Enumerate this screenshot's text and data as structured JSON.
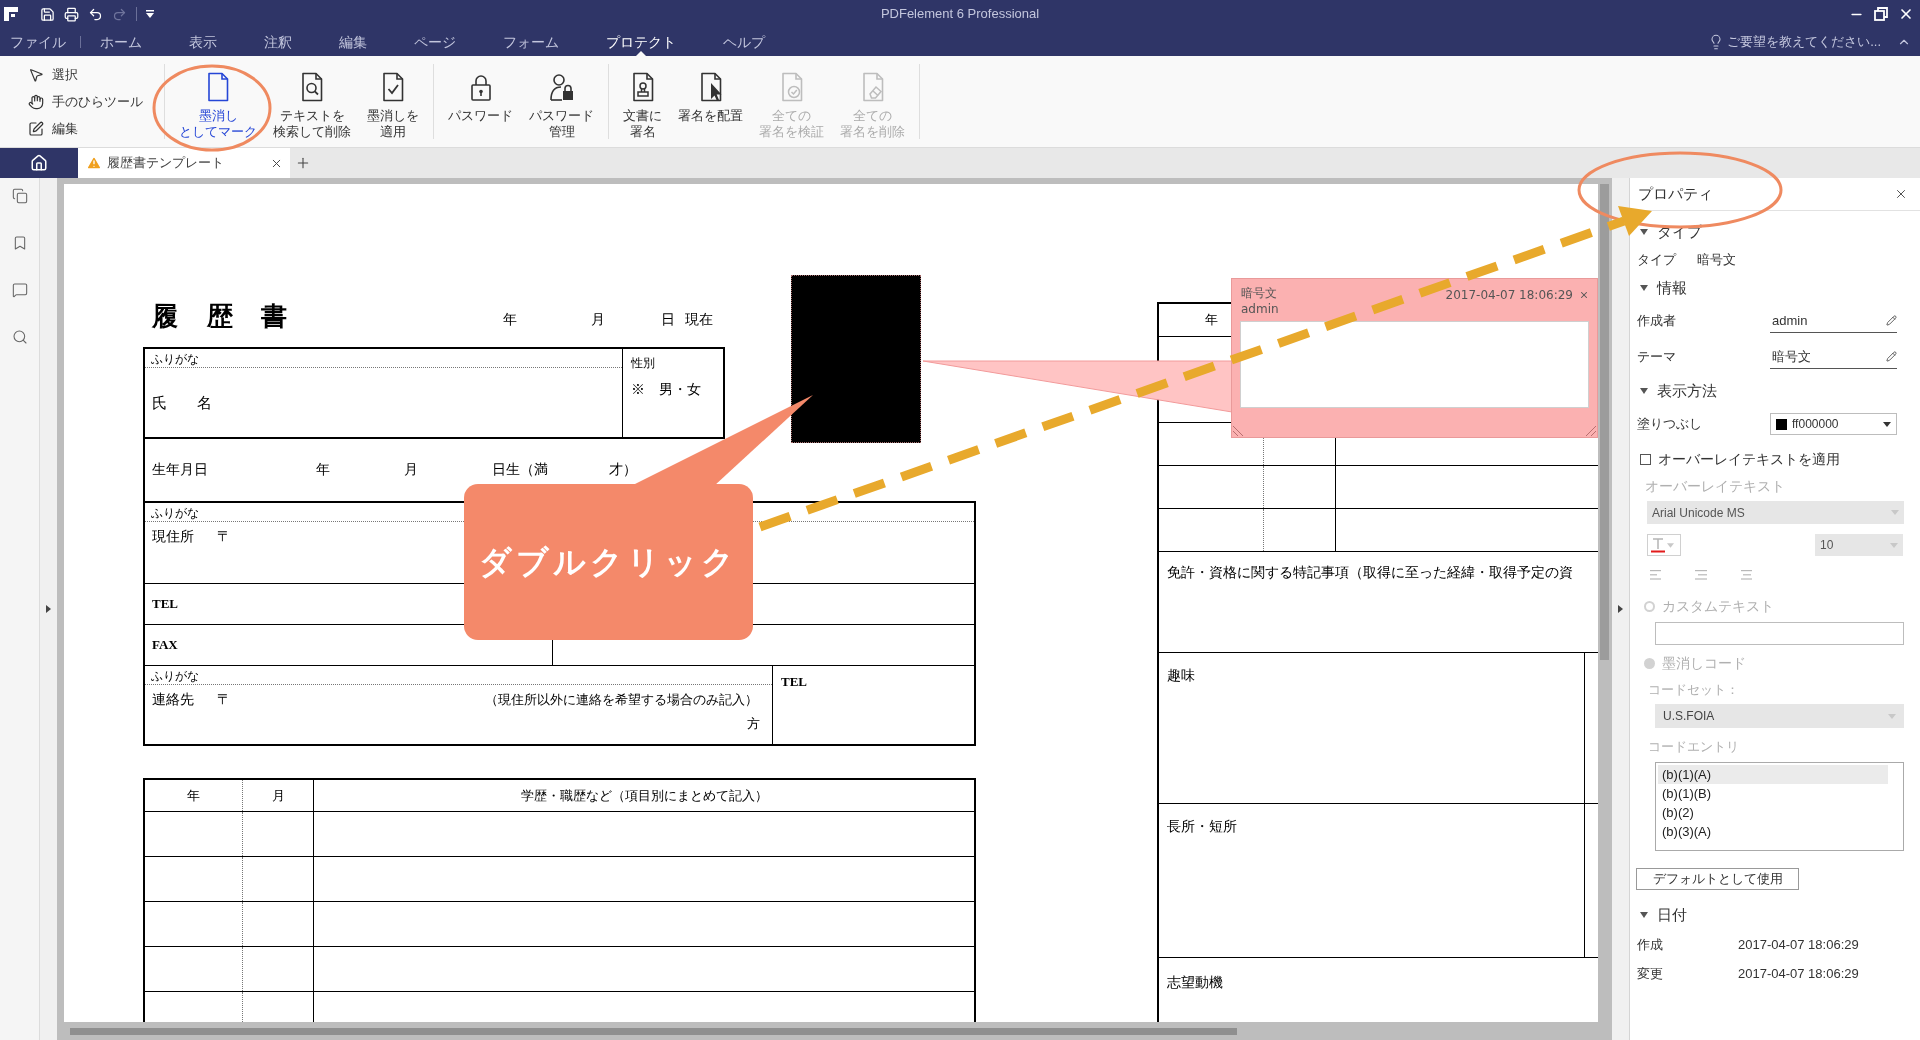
{
  "window": {
    "title": "PDFelement 6 Professional"
  },
  "quick_access": [
    {
      "kind": "save",
      "disabled": false
    },
    {
      "kind": "print",
      "disabled": false
    },
    {
      "kind": "undo",
      "disabled": false
    },
    {
      "kind": "redo",
      "disabled": true
    },
    {
      "kind": "customize",
      "disabled": false
    }
  ],
  "menu": [
    {
      "label": "ファイル",
      "selected": false
    },
    {
      "label": "ホーム",
      "selected": false
    },
    {
      "label": "表示",
      "selected": false
    },
    {
      "label": "注釈",
      "selected": false
    },
    {
      "label": "編集",
      "selected": false
    },
    {
      "label": "ページ",
      "selected": false
    },
    {
      "label": "フォーム",
      "selected": false
    },
    {
      "label": "プロテクト",
      "selected": true
    },
    {
      "label": "ヘルプ",
      "selected": false
    }
  ],
  "feedback": "ご要望を教えてください...",
  "ribbon": {
    "tools": [
      {
        "kind": "select",
        "label": "選択"
      },
      {
        "kind": "hand",
        "label": "手のひらツール"
      },
      {
        "kind": "edit",
        "label": "編集"
      }
    ],
    "groups": [
      [
        {
          "kind": "mark",
          "lines": [
            "墨消し",
            "としてマーク"
          ],
          "selected": true,
          "disabled": false
        },
        {
          "kind": "search",
          "lines": [
            "テキストを",
            "検索して削除"
          ],
          "selected": false,
          "disabled": false
        },
        {
          "kind": "apply",
          "lines": [
            "墨消しを",
            "適用"
          ],
          "selected": false,
          "disabled": false
        }
      ],
      [
        {
          "kind": "password",
          "lines": [
            "パスワード"
          ],
          "selected": false,
          "disabled": false
        },
        {
          "kind": "password_manage",
          "lines": [
            "パスワード",
            "管理"
          ],
          "selected": false,
          "disabled": false
        }
      ],
      [
        {
          "kind": "sign",
          "lines": [
            "文書に",
            "署名"
          ],
          "selected": false,
          "disabled": false
        },
        {
          "kind": "place_signature",
          "lines": [
            "署名を配置"
          ],
          "selected": false,
          "disabled": false
        },
        {
          "kind": "verify_all",
          "lines": [
            "全ての",
            "署名を検証"
          ],
          "selected": false,
          "disabled": true
        },
        {
          "kind": "remove_all",
          "lines": [
            "全ての",
            "署名を削除"
          ],
          "selected": false,
          "disabled": true
        }
      ]
    ]
  },
  "document_tabs": [
    {
      "label": "履歴書テンプレート",
      "selected": true,
      "warning": true
    }
  ],
  "sidebar": [
    {
      "kind": "pages"
    },
    {
      "kind": "bookmarks"
    },
    {
      "kind": "comments"
    },
    {
      "kind": "search"
    }
  ],
  "resume": {
    "title": "履 歴 書",
    "date": [
      "年",
      "月",
      "日 現在"
    ],
    "name_row": {
      "furigana": "ふりがな",
      "label": "氏 名",
      "gender_label": "性別",
      "gender": "※ 男・女"
    },
    "birth_row": [
      "生年月日",
      "年",
      "月",
      "日生（満",
      "才）"
    ],
    "address_row": {
      "furigana": "ふりがな",
      "label": "現住所",
      "postal": "〒"
    },
    "tel_row": "TEL",
    "fax_row": "FAX",
    "contact_row": {
      "furigana": "ふりがな",
      "label": "連絡先",
      "postal": "〒",
      "note": "（現住所以外に連絡を希望する場合のみ記入）",
      "suffix": "方",
      "tel": "TEL"
    },
    "history_table": {
      "columns": [
        "年",
        "月",
        "学歴・職歴など（項目別にまとめて記入）"
      ]
    },
    "licenses_table": {
      "columns": [
        "年"
      ],
      "remarks": "免許・資格に関する特記事項（取得に至った経緯・取得予定の資"
    },
    "hobbies": "趣味",
    "strengths": "長所・短所",
    "motivation": "志望動機"
  },
  "note": {
    "subject": "暗号文",
    "author": "admin",
    "date": "2017-04-07 18:06:29"
  },
  "callout": "ダブルクリック",
  "properties": {
    "title": "プロパティ",
    "type": {
      "heading": "タイプ",
      "expanded": true,
      "label": "タイプ",
      "value": "暗号文"
    },
    "info": {
      "heading": "情報",
      "expanded": true,
      "fields": [
        {
          "label": "作成者",
          "value": "admin"
        },
        {
          "label": "テーマ",
          "value": "暗号文"
        }
      ]
    },
    "appearance": {
      "heading": "表示方法",
      "expanded": true,
      "fill_label": "塗りつぶし",
      "fill_value": "ff000000",
      "overlay_checkbox": {
        "label": "オーバーレイテキストを適用",
        "checked": false
      },
      "overlay": {
        "disabled": true,
        "label": "オーバーレイテキスト",
        "font": "Arial Unicode MS",
        "font_size": "10"
      },
      "redaction_text": {
        "disabled": true,
        "options": [
          {
            "label": "カスタムテキスト",
            "selected": false
          },
          {
            "label": "墨消しコード",
            "selected": true
          }
        ],
        "code_set_label": "コードセット：",
        "code_set": "U.S.FOIA",
        "code_entry_label": "コードエントリ",
        "code_entries": [
          {
            "label": "(b)(1)(A)",
            "selected": true
          },
          {
            "label": "(b)(1)(B)",
            "selected": false
          },
          {
            "label": "(b)(2)",
            "selected": false
          },
          {
            "label": "(b)(3)(A)",
            "selected": false
          }
        ]
      },
      "default_button": "デフォルトとして使用"
    },
    "date": {
      "heading": "日付",
      "expanded": true,
      "rows": [
        {
          "label": "作成",
          "value": "2017-04-07 18:06:29"
        },
        {
          "label": "変更",
          "value": "2017-04-07 18:06:29"
        }
      ]
    }
  }
}
